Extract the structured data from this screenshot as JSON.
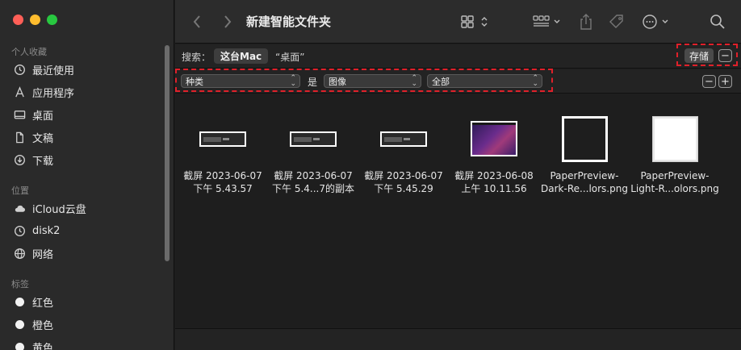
{
  "window": {
    "title": "新建智能文件夹"
  },
  "sidebar": {
    "favorites_title": "个人收藏",
    "favorites": [
      {
        "label": "最近使用",
        "icon": "clock-icon"
      },
      {
        "label": "应用程序",
        "icon": "applications-icon"
      },
      {
        "label": "桌面",
        "icon": "desktop-icon"
      },
      {
        "label": "文稿",
        "icon": "document-icon"
      },
      {
        "label": "下载",
        "icon": "download-icon"
      }
    ],
    "locations_title": "位置",
    "locations": [
      {
        "label": "iCloud云盘",
        "icon": "cloud-icon"
      },
      {
        "label": "disk2",
        "icon": "clock-icon"
      },
      {
        "label": "网络",
        "icon": "network-icon"
      }
    ],
    "tags_title": "标签",
    "tags": [
      {
        "label": "红色"
      },
      {
        "label": "橙色"
      },
      {
        "label": "黄色"
      }
    ]
  },
  "search": {
    "label": "搜索：",
    "scope_active": "这台Mac",
    "scope_other": "“桌面”",
    "save_label": "存储",
    "minus": "−",
    "plus": "+"
  },
  "criteria": {
    "attribute": "种类",
    "operator": "是",
    "value": "图像",
    "sub_value": "全部"
  },
  "files": [
    {
      "line1": "截屏 2023-06-07",
      "line2": "下午 5.43.57",
      "thumb": "strip"
    },
    {
      "line1": "截屏 2023-06-07",
      "line2": "下午 5.4...7的副本",
      "thumb": "strip"
    },
    {
      "line1": "截屏 2023-06-07",
      "line2": "下午 5.45.29",
      "thumb": "strip"
    },
    {
      "line1": "截屏 2023-06-08",
      "line2": "上午 10.11.56",
      "thumb": "desktop"
    },
    {
      "line1": "PaperPreview-",
      "line2": "Dark-Re...lors.png",
      "thumb": "dark"
    },
    {
      "line1": "PaperPreview-",
      "line2": "Light-R...olors.png",
      "thumb": "light"
    }
  ],
  "colors": {
    "highlight": "#e0202a",
    "sidebar_bg": "#2a2a2a",
    "main_bg": "#1e1e1e"
  }
}
